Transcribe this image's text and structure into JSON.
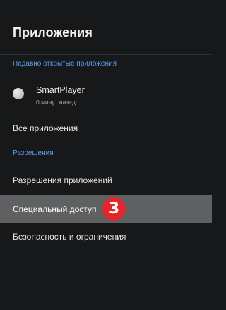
{
  "header": {
    "title": "Приложения"
  },
  "recent": {
    "section_label": "Недавно открытые приложения",
    "apps": [
      {
        "name": "SmartPlayer",
        "subtitle": "0 минут назад",
        "icon": "app-disc-icon"
      }
    ]
  },
  "menu": {
    "all_apps": "Все приложения"
  },
  "permissions": {
    "section_label": "Разрешения",
    "items": [
      {
        "label": "Разрешения приложений"
      },
      {
        "label": "Специальный доступ",
        "selected": true
      },
      {
        "label": "Безопасность и ограничения"
      }
    ]
  },
  "annotation": {
    "step_number": "3",
    "color": "#e4252c"
  },
  "colors": {
    "background": "#17181a",
    "section_header": "#5b9ff0",
    "selected_row": "#5f6062"
  }
}
